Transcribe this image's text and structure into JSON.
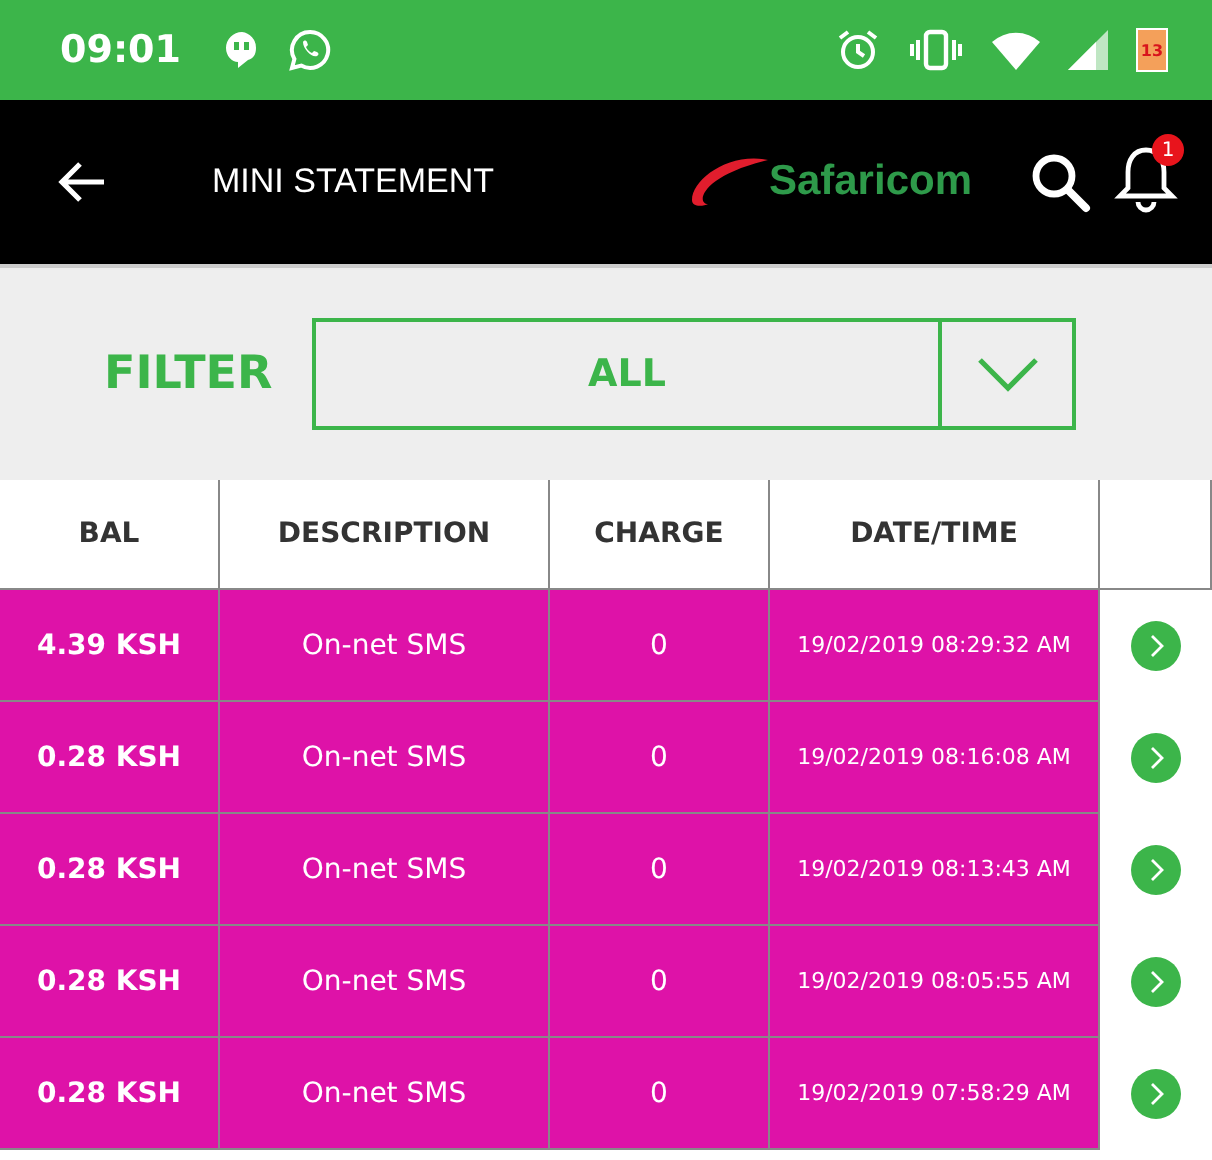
{
  "status_bar": {
    "time": "09:01",
    "battery": "13"
  },
  "header": {
    "title": "MINI STATEMENT",
    "logo": "Safaricom",
    "notification_count": "1"
  },
  "filter": {
    "label": "FILTER",
    "value": "ALL"
  },
  "table": {
    "columns": [
      "BAL",
      "DESCRIPTION",
      "CHARGE",
      "DATE/TIME"
    ],
    "rows": [
      {
        "bal": "4.39 KSH",
        "description": "On-net SMS",
        "charge": "0",
        "datetime": "19/02/2019 08:29:32 AM"
      },
      {
        "bal": "0.28 KSH",
        "description": "On-net SMS",
        "charge": "0",
        "datetime": "19/02/2019 08:16:08 AM"
      },
      {
        "bal": "0.28 KSH",
        "description": "On-net SMS",
        "charge": "0",
        "datetime": "19/02/2019 08:13:43 AM"
      },
      {
        "bal": "0.28 KSH",
        "description": "On-net SMS",
        "charge": "0",
        "datetime": "19/02/2019 08:05:55 AM"
      },
      {
        "bal": "0.28 KSH",
        "description": "On-net SMS",
        "charge": "0",
        "datetime": "19/02/2019 07:58:29 AM"
      }
    ]
  }
}
